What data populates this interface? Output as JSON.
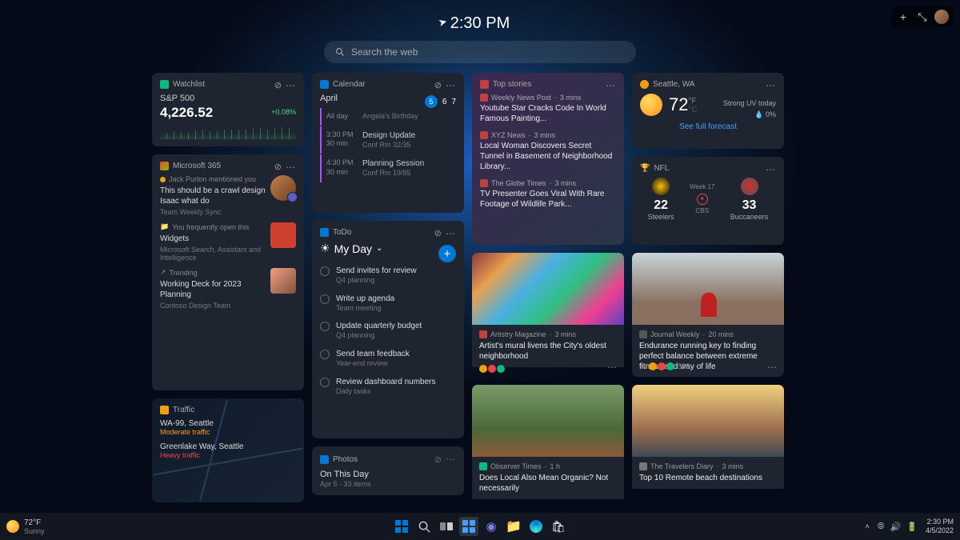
{
  "time": "2:30 PM",
  "search": {
    "placeholder": "Search the web"
  },
  "topbar": {
    "add": "+",
    "resize": "⤡"
  },
  "watchlist": {
    "header": "Watchlist",
    "name": "S&P 500",
    "value": "4,226.52",
    "change": "+0.08%"
  },
  "m365": {
    "header": "Microsoft 365",
    "items": [
      {
        "meta": "Jack Purton mentioned you",
        "title": "This should be a crawl design Isaac what do",
        "sub": "Team Weekly Sync"
      },
      {
        "meta": "You frequently open this",
        "title": "Widgets",
        "sub": "Microsoft Search, Assistant and Intelligence"
      },
      {
        "meta": "Trending",
        "title": "Working Deck for 2023 Planning",
        "sub": "Contoso Design Team"
      }
    ]
  },
  "traffic": {
    "header": "Traffic",
    "routes": [
      {
        "name": "WA-99, Seattle",
        "status": "Moderate traffic"
      },
      {
        "name": "Greenlake Way, Seattle",
        "status": "Heavy traffic"
      }
    ]
  },
  "calendar": {
    "header": "Calendar",
    "month": "April",
    "days": [
      "5",
      "6",
      "7"
    ],
    "events": [
      {
        "time": "All day",
        "dur": "",
        "title": "Angela's Birthday",
        "loc": ""
      },
      {
        "time": "3:30 PM",
        "dur": "30 min",
        "title": "Design Update",
        "loc": "Conf Rm 32/35"
      },
      {
        "time": "4:30 PM",
        "dur": "30 min",
        "title": "Planning Session",
        "loc": "Conf Rm 19/85"
      }
    ]
  },
  "todo": {
    "header": "ToDo",
    "list": "My Day",
    "tasks": [
      {
        "title": "Send invites for review",
        "sub": "Q4 planning"
      },
      {
        "title": "Write up agenda",
        "sub": "Team meeting"
      },
      {
        "title": "Update quarterly budget",
        "sub": "Q4 planning"
      },
      {
        "title": "Send team feedback",
        "sub": "Year-end review"
      },
      {
        "title": "Review dashboard numbers",
        "sub": "Daily tasks"
      }
    ]
  },
  "photos": {
    "header": "Photos",
    "title": "On This Day",
    "sub": "Apr 5  ·  33 items"
  },
  "topstories": {
    "header": "Top stories",
    "stories": [
      {
        "src": "Weekly News Post",
        "time": "3 mins",
        "title": "Youtube Star Cracks Code In World Famous Painting..."
      },
      {
        "src": "XYZ News",
        "time": "3 mins",
        "title": "Local Woman Discovers Secret Tunnel in Basement of Neighborhood Library..."
      },
      {
        "src": "The Globe Times",
        "time": "3 mins",
        "title": "TV Presenter Goes Viral With Rare Footage of Wildlife Park..."
      }
    ]
  },
  "weather": {
    "header": "Seattle, WA",
    "temp": "72",
    "unit_f": "°F",
    "unit_c": "°C",
    "detail1": "Strong UV today",
    "detail2": "0%",
    "link": "See full forecast"
  },
  "nfl": {
    "header": "NFL",
    "week": "Week 17",
    "teams": [
      {
        "name": "Steelers",
        "score": "22"
      },
      {
        "name": "Buccaneers",
        "score": "33"
      }
    ],
    "network": "CBS"
  },
  "feeds": [
    {
      "src": "Artistry Magazine",
      "time": "3 mins",
      "title": "Artist's mural livens the City's oldest neighborhood"
    },
    {
      "src": "Journal Weekly",
      "time": "20 mins",
      "title": "Endurance running key to finding perfect balance between extreme fitness and way of life",
      "count": "589"
    },
    {
      "src": "Observer Times",
      "time": "1 h",
      "title": "Does Local Also Mean Organic? Not necessarily"
    },
    {
      "src": "The Travelers Diary",
      "time": "3 mins",
      "title": "Top 10 Remote beach destinations"
    }
  ],
  "taskbar": {
    "weather": {
      "temp": "72°F",
      "cond": "Sunny"
    },
    "time": "2:30 PM",
    "date": "4/5/2022"
  }
}
